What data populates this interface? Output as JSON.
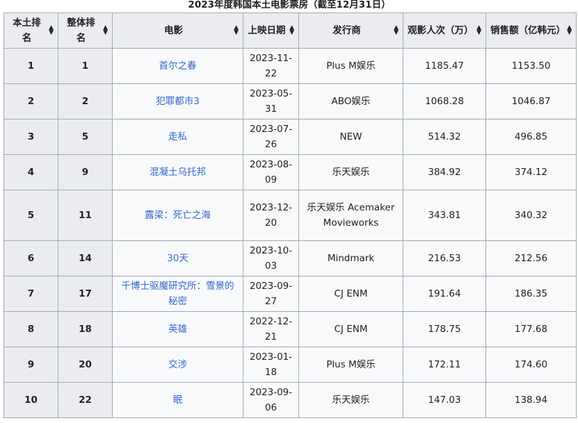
{
  "caption": "2023年度韩国本土电影票房（截至12月31日）",
  "headers": [
    "本土排名",
    "整体排名",
    "电影",
    "上映日期",
    "发行商",
    "观影人次（万）",
    "销售额（亿韩元）"
  ],
  "rows": [
    {
      "rank": "1",
      "overall": "1",
      "film": "首尔之春",
      "date": "2023-11-22",
      "dist": "Plus M娱乐",
      "admissions": "1185.47",
      "sales": "1153.50"
    },
    {
      "rank": "2",
      "overall": "2",
      "film": "犯罪都市3",
      "date": "2023-05-31",
      "dist": "ABO娱乐",
      "admissions": "1068.28",
      "sales": "1046.87"
    },
    {
      "rank": "3",
      "overall": "5",
      "film": "走私",
      "date": "2023-07-26",
      "dist": "NEW",
      "admissions": "514.32",
      "sales": "496.85"
    },
    {
      "rank": "4",
      "overall": "9",
      "film": "混凝土乌托邦",
      "date": "2023-08-09",
      "dist": "乐天娱乐",
      "admissions": "384.92",
      "sales": "374.12"
    },
    {
      "rank": "5",
      "overall": "11",
      "film": "露梁：死亡之海",
      "date": "2023-12-20",
      "dist": "乐天娱乐 Acemaker Movieworks",
      "admissions": "343.81",
      "sales": "340.32"
    },
    {
      "rank": "6",
      "overall": "14",
      "film": "30天",
      "date": "2023-10-03",
      "dist": "Mindmark",
      "admissions": "216.53",
      "sales": "212.56"
    },
    {
      "rank": "7",
      "overall": "17",
      "film": "千博士驱魔研究所：雪景的秘密",
      "date": "2023-09-27",
      "dist": "CJ ENM",
      "admissions": "191.64",
      "sales": "186.35"
    },
    {
      "rank": "8",
      "overall": "18",
      "film": "英雄",
      "date": "2022-12-21",
      "dist": "CJ ENM",
      "admissions": "178.75",
      "sales": "177.68"
    },
    {
      "rank": "9",
      "overall": "20",
      "film": "交涉",
      "date": "2023-01-18",
      "dist": "Plus M娱乐",
      "admissions": "172.11",
      "sales": "174.60"
    },
    {
      "rank": "10",
      "overall": "22",
      "film": "眠",
      "date": "2023-09-06",
      "dist": "乐天娱乐",
      "admissions": "147.03",
      "sales": "138.94"
    }
  ]
}
